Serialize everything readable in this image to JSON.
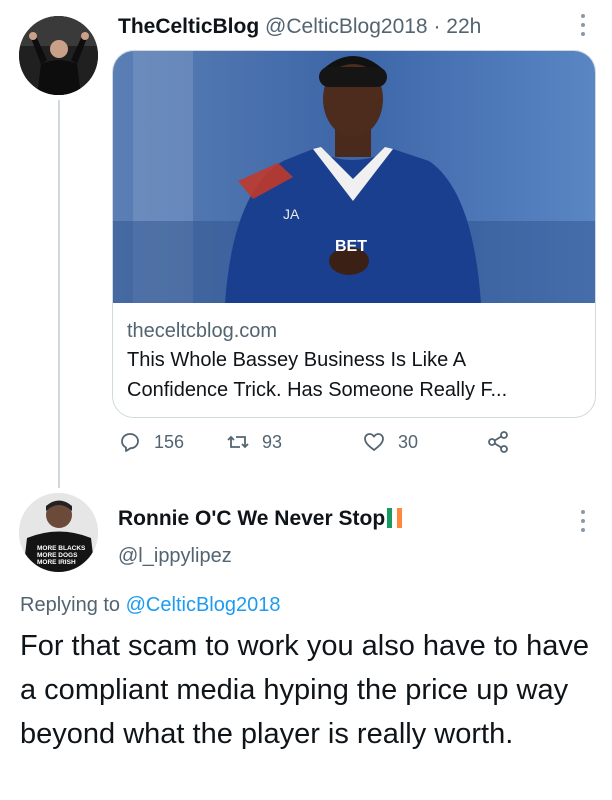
{
  "tweet1": {
    "display_name": "TheCelticBlog",
    "handle": "@CelticBlog2018",
    "separator": "·",
    "time": "22h",
    "avatar_icon": "manager-avatar-icon",
    "card": {
      "domain": "theceltcblog.com",
      "title_line1": "This Whole Bassey Business Is Like A",
      "title_line2": "Confidence Trick. Has Someone Really F...",
      "shirt_text": "JA",
      "sponsor_text": "BET"
    },
    "actions": {
      "reply_count": "156",
      "retweet_count": "93",
      "like_count": "30"
    }
  },
  "tweet2": {
    "display_name": "Ronnie O'C We Never Stop",
    "handle": "@l_ippylipez",
    "shirt_lines": [
      "MORE BLACKS",
      "MORE DOGS",
      "MORE IRISH"
    ],
    "replying_prefix": "Replying to",
    "replying_to": "@CelticBlog2018",
    "text": "For that scam to work you also have to have a compliant media hyping the price up way beyond what the player is really worth."
  },
  "colors": {
    "text": "#0f1419",
    "secondary": "#536471",
    "link": "#1d9bf0",
    "border": "#cfd9de",
    "flag_green": "#169b62",
    "flag_orange": "#ff883e"
  }
}
